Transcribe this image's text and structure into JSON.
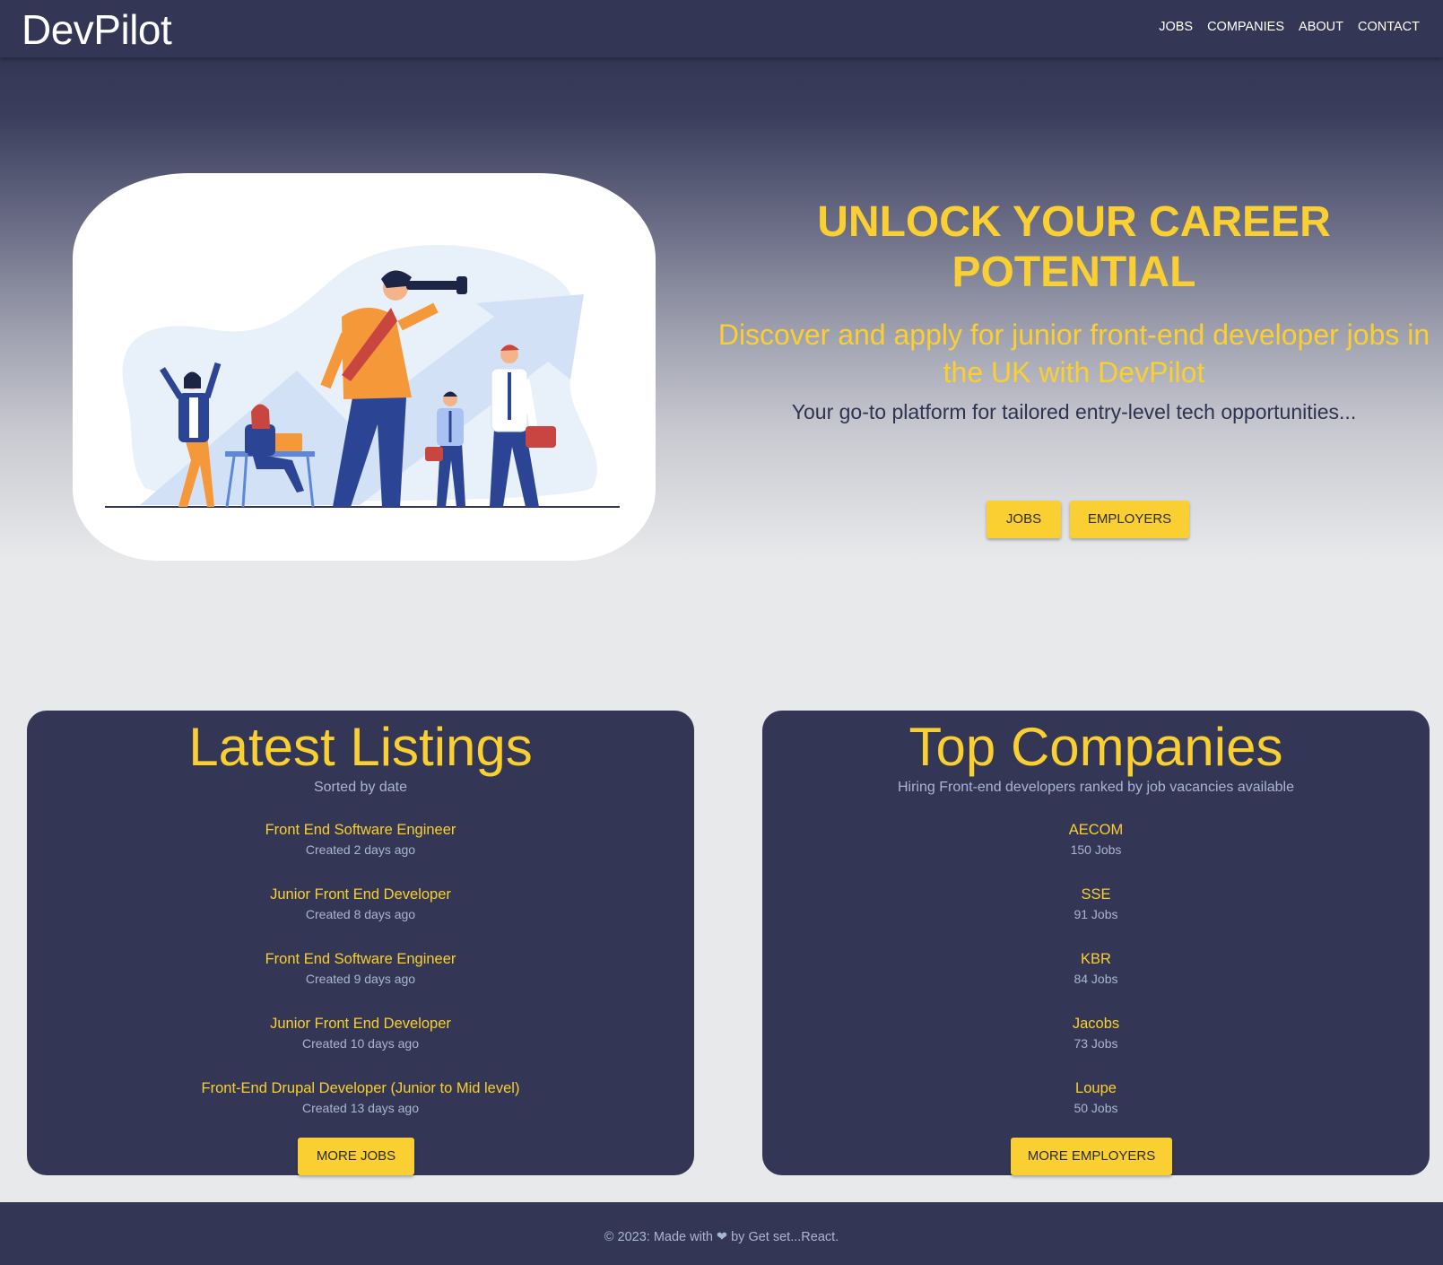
{
  "nav": {
    "brand": "DevPilot",
    "links": [
      "JOBS",
      "COMPANIES",
      "ABOUT",
      "CONTACT"
    ]
  },
  "hero": {
    "title": "UNLOCK YOUR CAREER POTENTIAL",
    "subtitle": "Discover and apply for junior front-end developer jobs in the UK with DevPilot",
    "tagline": "Your go-to platform for tailored entry-level tech opportunities...",
    "buttons": [
      "JOBS",
      "EMPLOYERS"
    ]
  },
  "listings": {
    "title": "Latest Listings",
    "subtitle": "Sorted by date",
    "items": [
      {
        "title": "Front End Software Engineer",
        "meta": "Created 2 days ago"
      },
      {
        "title": "Junior Front End Developer",
        "meta": "Created 8 days ago"
      },
      {
        "title": "Front End Software Engineer",
        "meta": "Created 9 days ago"
      },
      {
        "title": "Junior Front End Developer",
        "meta": "Created 10 days ago"
      },
      {
        "title": "Front-End Drupal Developer (Junior to Mid level)",
        "meta": "Created 13 days ago"
      }
    ],
    "button": "MORE JOBS"
  },
  "companies": {
    "title": "Top Companies",
    "subtitle": "Hiring Front-end developers ranked by job vacancies available",
    "items": [
      {
        "title": "AECOM",
        "meta": "150 Jobs"
      },
      {
        "title": "SSE",
        "meta": "91 Jobs"
      },
      {
        "title": "KBR",
        "meta": "84 Jobs"
      },
      {
        "title": "Jacobs",
        "meta": "73 Jobs"
      },
      {
        "title": "Loupe",
        "meta": "50 Jobs"
      }
    ],
    "button": "MORE EMPLOYERS"
  },
  "footer": {
    "text": "© 2023: Made with ❤ by Get set...React."
  },
  "colors": {
    "navy": "#333755",
    "accent": "#f9cf31",
    "muted": "#a7b6d4",
    "background": "#e8e9eb"
  }
}
